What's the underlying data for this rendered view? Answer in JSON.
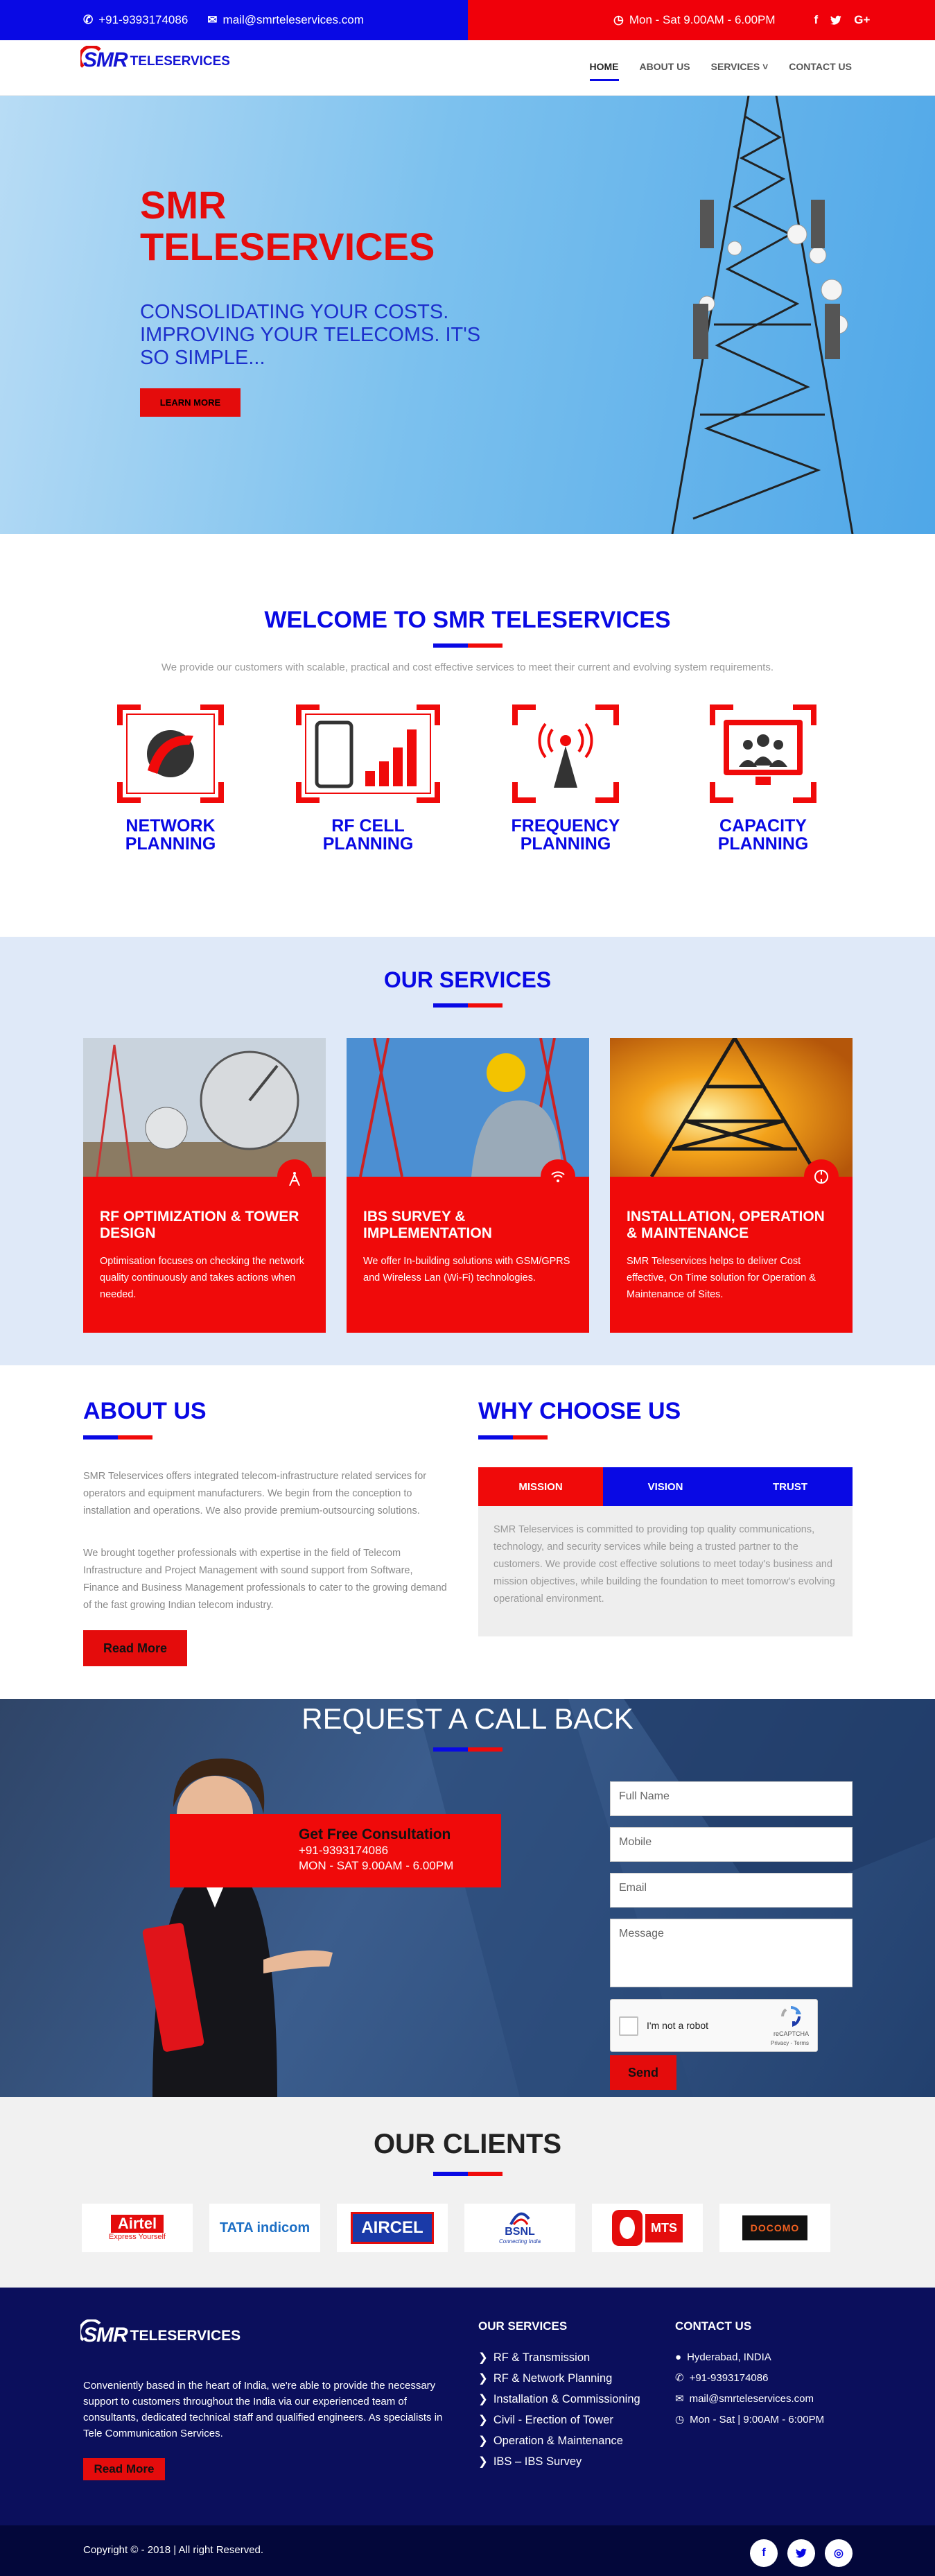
{
  "topbar": {
    "phone": "+91-9393174086",
    "email": "mail@smrteleservices.com",
    "hours": "Mon - Sat 9.00AM - 6.00PM",
    "social": [
      "f",
      "twitter-bird",
      "G+"
    ]
  },
  "brand": {
    "logo_mark": "SMR",
    "logo_text": "TELESERVICES"
  },
  "nav": {
    "items": [
      "HOME",
      "ABOUT US",
      "SERVICES",
      "CONTACT US"
    ]
  },
  "hero": {
    "title": "SMR TELESERVICES",
    "subtitle": "CONSOLIDATING YOUR COSTS. IMPROVING YOUR TELECOMS. IT'S SO SIMPLE...",
    "button": "LEARN MORE"
  },
  "welcome": {
    "title": "WELCOME TO SMR TELESERVICES",
    "text": "We provide our customers with scalable, practical and cost effective services to meet their current and evolving system requirements.",
    "features": [
      {
        "label": "NETWORK PLANNING",
        "icon": "globe-phone-icon"
      },
      {
        "label": "RF CELL PLANNING",
        "icon": "mobile-signal-icon"
      },
      {
        "label": "FREQUENCY PLANNING",
        "icon": "antenna-tower-icon"
      },
      {
        "label": "CAPACITY PLANNING",
        "icon": "group-monitor-icon"
      }
    ]
  },
  "services": {
    "title": "OUR SERVICES",
    "cards": [
      {
        "title": "RF OPTIMIZATION & TOWER DESIGN",
        "text": "Optimisation focuses on checking the network quality continuously and takes actions when needed.",
        "icon": "tower-icon"
      },
      {
        "title": "IBS SURVEY & IMPLEMENTATION",
        "text": "We offer In-building solutions with GSM/GPRS and Wireless Lan (Wi-Fi) technologies.",
        "icon": "wifi-icon"
      },
      {
        "title": "INSTALLATION, OPERATION & MAINTENANCE",
        "text": "SMR Teleservices helps to deliver Cost effective, On Time solution for Operation & Maintenance of Sites.",
        "icon": "maintenance-icon"
      }
    ]
  },
  "about": {
    "title": "ABOUT US",
    "p1": "SMR Teleservices offers integrated telecom-infrastructure related services for operators and equipment manufacturers. We begin from the conception to installation and operations. We also provide premium-outsourcing solutions.",
    "p2": "We brought together professionals with expertise in the field of Telecom Infrastructure and Project Management with sound support from Software, Finance and Business Management professionals to cater to the growing demand of the fast growing Indian telecom industry.",
    "button": "Read More"
  },
  "why": {
    "title": "WHY CHOOSE US",
    "tabs": [
      "MISSION",
      "VISION",
      "TRUST"
    ],
    "text": "SMR Teleservices is committed to providing top quality communications, technology, and security services while being a trusted partner to the customers. We provide cost effective solutions to meet today's business and mission objectives, while building the foundation to meet tomorrow's evolving operational environment."
  },
  "callback": {
    "title": "REQUEST A CALL BACK",
    "consult_title": "Get Free Consultation",
    "consult_phone": "+91-9393174086",
    "consult_hours": "MON - SAT 9.00AM - 6.00PM",
    "form": {
      "name": "Full Name",
      "mobile": "Mobile",
      "email": "Email",
      "message": "Message",
      "captcha": "I'm not a robot",
      "captcha_brand": "reCAPTCHA",
      "captcha_terms": "Privacy - Terms",
      "send": "Send"
    }
  },
  "clients": {
    "title": "OUR CLIENTS",
    "logos": [
      "Airtel",
      "TATA indicom",
      "AIRCEL",
      "BSNL",
      "MTS",
      "DOCOMO"
    ],
    "airtel_tag": "Express Yourself",
    "bsnl_tag": "Connecting India"
  },
  "footer": {
    "logo_mark": "SMR",
    "logo_text": "TELESERVICES",
    "desc": "Conveniently based in the heart of India, we're able to provide the necessary support to customers throughout the India via our experienced team of consultants, dedicated technical staff and qualified engineers. As specialists in Tele Communication Services.",
    "button": "Read More",
    "services_title": "OUR SERVICES",
    "services": [
      "RF & Transmission",
      "RF & Network Planning",
      "Installation & Commissioning",
      "Civil - Erection of Tower",
      "Operation & Maintenance",
      "IBS – IBS Survey"
    ],
    "contact_title": "CONTACT US",
    "contact": [
      "Hyderabad, INDIA",
      "+91-9393174086",
      "mail@smrteleservices.com",
      "Mon - Sat | 9:00AM - 6:00PM"
    ],
    "copyright": "Copyright © - 2018 | All right Reserved."
  },
  "colors": {
    "blue": "#0909e4",
    "red": "#f00a0a",
    "navy": "#0b0f5c"
  }
}
